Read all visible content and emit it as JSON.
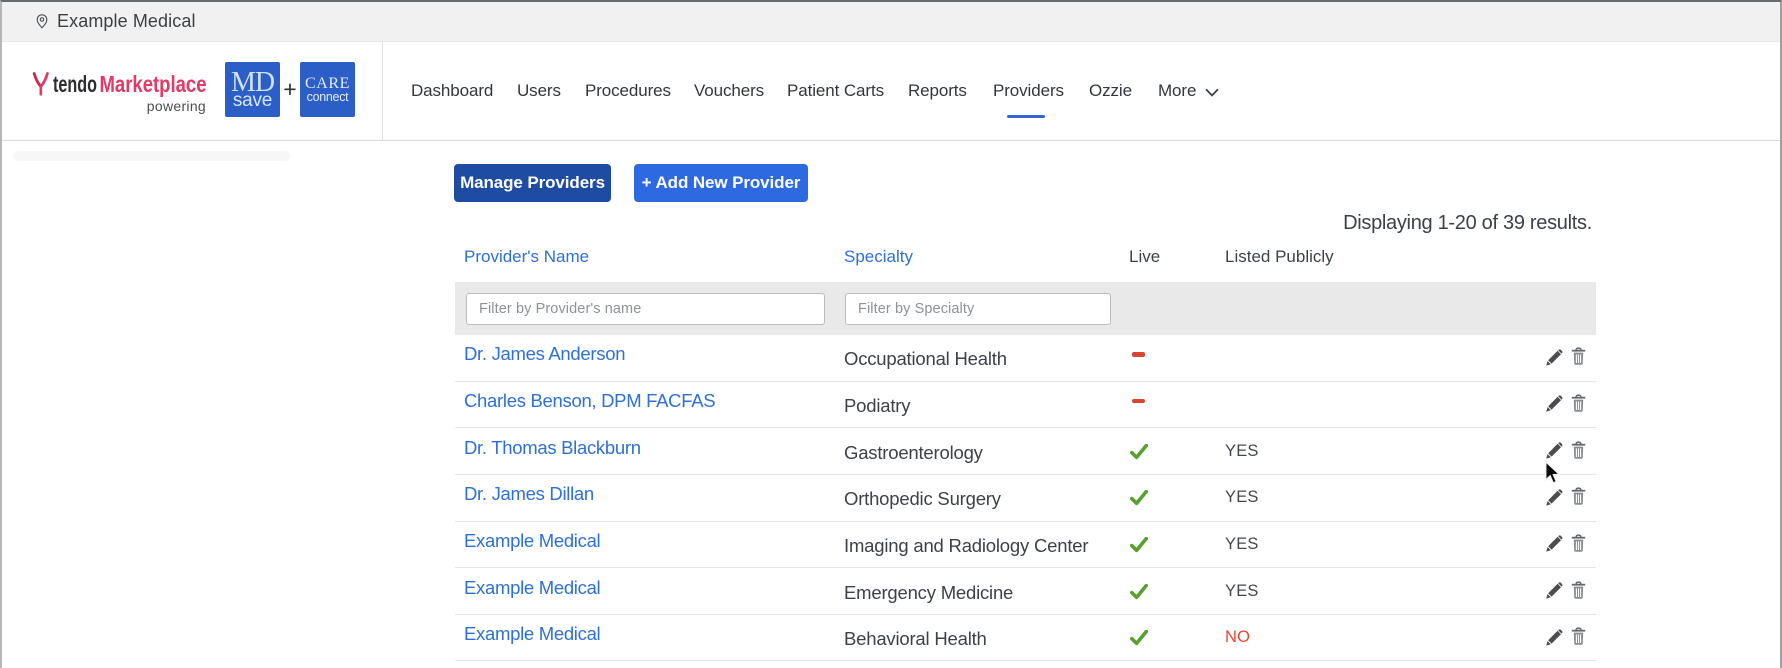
{
  "topbar": {
    "org_name": "Example Medical"
  },
  "brand": {
    "tendo": "tendo",
    "marketplace": "Marketplace",
    "powering": "powering",
    "mdsave_top": "MD",
    "mdsave_bottom": "save",
    "plus": "+",
    "careconnect_top": "CARE",
    "careconnect_bottom": "connect"
  },
  "nav": {
    "items": [
      {
        "label": "Dashboard",
        "active": false
      },
      {
        "label": "Users",
        "active": false
      },
      {
        "label": "Procedures",
        "active": false
      },
      {
        "label": "Vouchers",
        "active": false
      },
      {
        "label": "Patient Carts",
        "active": false
      },
      {
        "label": "Reports",
        "active": false
      },
      {
        "label": "Providers",
        "active": true
      },
      {
        "label": "Ozzie",
        "active": false
      }
    ],
    "more_label": "More"
  },
  "toolbar": {
    "manage_label": "Manage Providers",
    "add_label": "+ Add New Provider"
  },
  "results_summary": "Displaying 1-20 of 39 results.",
  "table": {
    "columns": {
      "name": "Provider's Name",
      "specialty": "Specialty",
      "live": "Live",
      "listed": "Listed Publicly"
    },
    "filters": {
      "name_placeholder": "Filter by Provider's name",
      "specialty_placeholder": "Filter by Specialty"
    },
    "rows": [
      {
        "name": "Dr. James Anderson",
        "specialty": "Occupational Health",
        "live": false,
        "listed": ""
      },
      {
        "name": "Charles Benson, DPM FACFAS",
        "specialty": "Podiatry",
        "live": false,
        "listed": ""
      },
      {
        "name": "Dr. Thomas Blackburn",
        "specialty": "Gastroenterology",
        "live": true,
        "listed": "YES"
      },
      {
        "name": "Dr. James Dillan",
        "specialty": "Orthopedic Surgery",
        "live": true,
        "listed": "YES"
      },
      {
        "name": "Example Medical",
        "specialty": "Imaging and Radiology Center",
        "live": true,
        "listed": "YES"
      },
      {
        "name": "Example Medical",
        "specialty": "Emergency Medicine",
        "live": true,
        "listed": "YES"
      },
      {
        "name": "Example Medical",
        "specialty": "Behavioral Health",
        "live": true,
        "listed": "NO"
      }
    ]
  },
  "colors": {
    "accent_blue": "#2e70d3",
    "nav_underline": "#3365d3",
    "btn_dark_blue": "#1d4ca2",
    "btn_blue": "#2d6ae2",
    "brand_pink": "#e23a68",
    "logo_box_blue": "#2c5ec7",
    "live_green": "#57a02e",
    "not_live_red": "#d9452f",
    "no_red": "#e8482f"
  }
}
